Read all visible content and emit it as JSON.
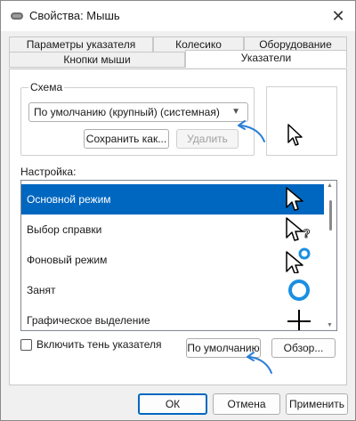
{
  "window": {
    "title": "Свойства: Мышь",
    "close_glyph": "✕"
  },
  "tabs": {
    "row1": [
      "Параметры указателя",
      "Колесико",
      "Оборудование"
    ],
    "row2": [
      "Кнопки мыши",
      "Указатели"
    ],
    "active": "Указатели"
  },
  "scheme": {
    "legend": "Схема",
    "selected": "По умолчанию (крупный) (системная)",
    "save_label": "Сохранить как...",
    "delete_label": "Удалить"
  },
  "settings": {
    "label": "Настройка:",
    "items": [
      {
        "label": "Основной режим",
        "icon": "arrow-cursor-icon",
        "selected": true
      },
      {
        "label": "Выбор справки",
        "icon": "help-cursor-icon",
        "selected": false
      },
      {
        "label": "Фоновый режим",
        "icon": "working-in-background-cursor-icon",
        "selected": false
      },
      {
        "label": "Занят",
        "icon": "busy-cursor-icon",
        "selected": false
      },
      {
        "label": "Графическое выделение",
        "icon": "precision-select-cursor-icon",
        "selected": false
      }
    ]
  },
  "shadow": {
    "label": "Включить тень указателя",
    "checked": false
  },
  "buttons": {
    "default_label": "По умолчанию",
    "browse_label": "Обзор..."
  },
  "footer": {
    "ok": "ОК",
    "cancel": "Отмена",
    "apply": "Применить"
  },
  "colors": {
    "selection": "#0067c0",
    "accent_ring": "#1a8fe3",
    "annotation_arrow": "#2a7fd4"
  }
}
